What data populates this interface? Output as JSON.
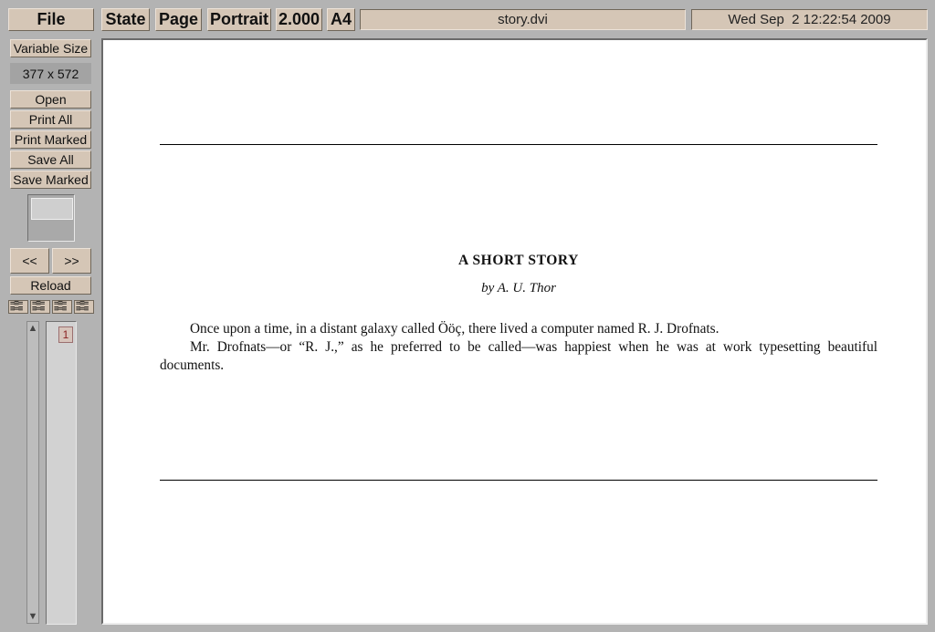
{
  "topbar": {
    "file_label": "File",
    "state_label": "State",
    "page_label": "Page",
    "orientation_label": "Portrait",
    "zoom_label": "2.000",
    "paper_label": "A4",
    "filename": "story.dvi",
    "datetime": "Wed Sep  2 12:22:54 2009"
  },
  "sidebar": {
    "variable_size_label": "Variable Size",
    "page_size": "377 x 572",
    "open_label": "Open",
    "print_all_label": "Print All",
    "print_marked_label": "Print Marked",
    "save_all_label": "Save All",
    "save_marked_label": "Save Marked",
    "prev_label": "<<",
    "next_label": ">>",
    "reload_label": "Reload",
    "scroll_up_icon": "▲",
    "scroll_down_icon": "▼",
    "page_number": "1"
  },
  "document": {
    "title": "A SHORT STORY",
    "author": "by A. U. Thor",
    "paragraph1": "Once upon a time, in a distant galaxy called Ööç, there lived a computer named R. J. Drofnats.",
    "paragraph2": "Mr. Drofnats—or “R. J.,” as he preferred to be called—was happiest when he was at work typesetting beautiful documents."
  },
  "colors": {
    "button_bg": "#d5c6b6",
    "window_bg": "#b3b3b3",
    "page_bg": "#ffffff"
  }
}
